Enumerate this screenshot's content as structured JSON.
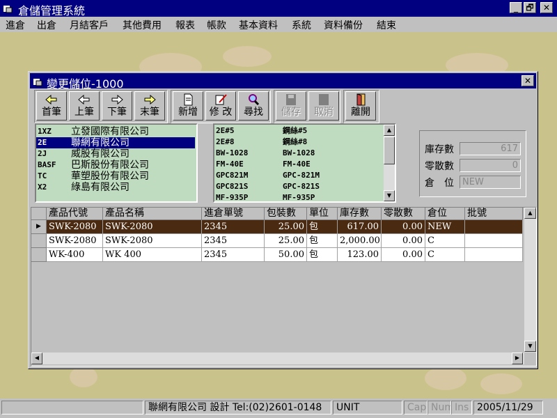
{
  "app": {
    "title": "倉儲管理系統",
    "colors": {
      "titlebar": "#000080",
      "selected_row": "#4a2a10",
      "list_bg": "#c0dcc0"
    }
  },
  "window_buttons": {
    "minimize": "_",
    "restore": "🗗",
    "close": "✕"
  },
  "menu": [
    "進倉",
    "出倉",
    "月結客戶",
    "其他費用",
    "報表",
    "帳款",
    "基本資料",
    "系統",
    "資料備份",
    "結束"
  ],
  "dialog": {
    "title": "變更儲位-1000",
    "toolbar": [
      {
        "label": "首筆",
        "icon": "arrow-left-first-icon",
        "enabled": true
      },
      {
        "label": "上筆",
        "icon": "arrow-left-icon",
        "enabled": true
      },
      {
        "label": "下筆",
        "icon": "arrow-right-icon",
        "enabled": true
      },
      {
        "label": "末筆",
        "icon": "arrow-right-last-icon",
        "enabled": true
      },
      {
        "label": "新增",
        "icon": "new-document-icon",
        "enabled": true
      },
      {
        "label": "修 改",
        "icon": "edit-pencil-icon",
        "enabled": true
      },
      {
        "label": "尋找",
        "icon": "magnifier-icon",
        "enabled": true
      },
      {
        "label": "儲存",
        "icon": "save-icon",
        "enabled": false
      },
      {
        "label": "取消",
        "icon": "cancel-icon",
        "enabled": false
      },
      {
        "label": "離開",
        "icon": "exit-door-icon",
        "enabled": true
      }
    ],
    "customers": [
      {
        "code": "1XZ",
        "name": "立發國際有限公司",
        "selected": false
      },
      {
        "code": "2E",
        "name": "聯網有限公司",
        "selected": true
      },
      {
        "code": "2J",
        "name": "威股有限公司",
        "selected": false
      },
      {
        "code": "BASF",
        "name": "巴斯股份有限公司",
        "selected": false
      },
      {
        "code": "TC",
        "name": "華塑股份有限公司",
        "selected": false
      },
      {
        "code": "X2",
        "name": "綠島有限公司",
        "selected": false
      }
    ],
    "products": [
      {
        "code": "2E#5",
        "name": "鋼絲#5"
      },
      {
        "code": "2E#8",
        "name": "鋼絲#8"
      },
      {
        "code": "BW-1028",
        "name": "BW-1028"
      },
      {
        "code": "FM-40E",
        "name": "FM-40E"
      },
      {
        "code": "GPC821M",
        "name": "GPC-821M"
      },
      {
        "code": "GPC821S",
        "name": "GPC-821S"
      },
      {
        "code": "MF-935P",
        "name": "MF-935P"
      }
    ],
    "info": {
      "stock_label": "庫存數",
      "stock_value": "617",
      "loose_label": "零散數",
      "loose_value": "0",
      "location_label": "倉　位",
      "location_value": "NEW"
    },
    "grid": {
      "columns": [
        "產品代號",
        "產品名稱",
        "進倉單號",
        "包裝數",
        "單位",
        "庫存數",
        "零散數",
        "倉位",
        "批號"
      ],
      "rows": [
        {
          "current": true,
          "cells": [
            "SWK-2080",
            "SWK-2080",
            "2345",
            "25.00",
            "包",
            "617.00",
            "0.00",
            "NEW",
            ""
          ]
        },
        {
          "current": false,
          "cells": [
            "SWK-2080",
            "SWK-2080",
            "2345",
            "25.00",
            "包",
            "2,000.00",
            "0.00",
            "C",
            ""
          ]
        },
        {
          "current": false,
          "cells": [
            "WK-400",
            "WK 400",
            "2345",
            "50.00",
            "包",
            "123.00",
            "0.00",
            "C",
            ""
          ]
        }
      ]
    }
  },
  "status": {
    "company": "聯網有限公司 設計 Tel:(02)2601-0148",
    "unit": "UNIT",
    "caps": "Caps",
    "num": "Num",
    "ins": "Ins",
    "date": "2005/11/29"
  }
}
